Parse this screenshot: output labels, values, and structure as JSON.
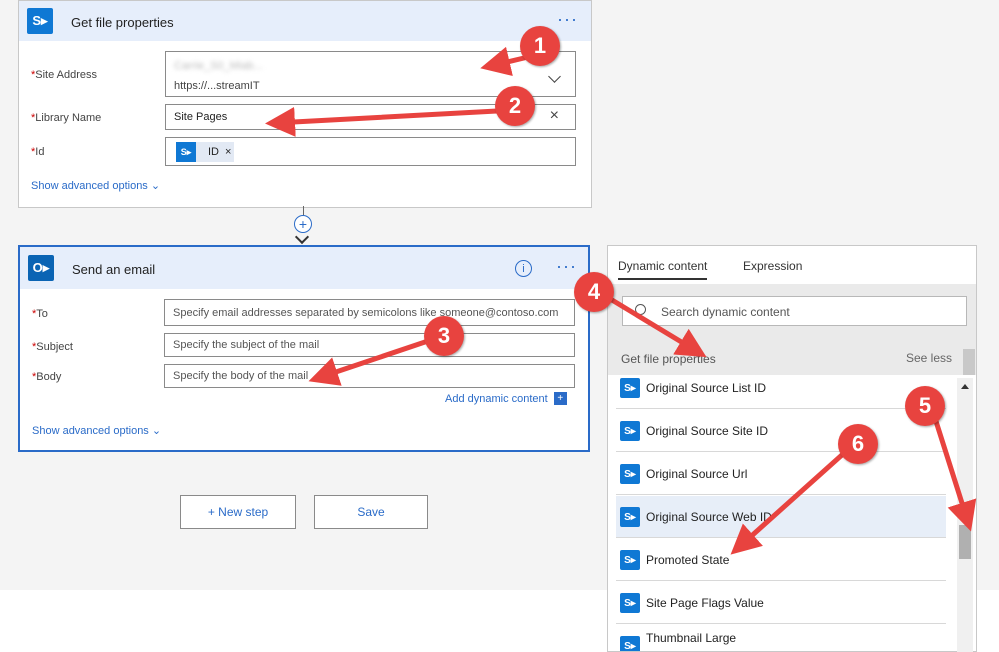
{
  "card1": {
    "title": "Get file properties",
    "site_address_label": "Site Address",
    "site_address_line1": "Carrie_S0_Miab...",
    "site_address_line2": "https://...streamIT",
    "library_label": "Library Name",
    "library_value": "Site Pages",
    "id_label": "Id",
    "id_token": "ID",
    "advanced": "Show advanced options"
  },
  "card2": {
    "title": "Send an email",
    "to_label": "To",
    "to_placeholder": "Specify email addresses separated by semicolons like someone@contoso.com",
    "subject_label": "Subject",
    "subject_placeholder": "Specify the subject of the mail",
    "body_label": "Body",
    "body_placeholder": "Specify the body of the mail",
    "add_dynamic": "Add dynamic content",
    "advanced": "Show advanced options"
  },
  "buttons": {
    "new_step": "+ New step",
    "save": "Save"
  },
  "panel": {
    "tab_dynamic": "Dynamic content",
    "tab_expression": "Expression",
    "search_placeholder": "Search dynamic content",
    "group_title": "Get file properties",
    "see_less": "See less",
    "items": [
      "Original Source List ID",
      "Original Source Site ID",
      "Original Source Url",
      "Original Source Web ID",
      "Promoted State",
      "Site Page Flags Value",
      "Thumbnail Large"
    ]
  },
  "markers": [
    "1",
    "2",
    "3",
    "4",
    "5",
    "6"
  ],
  "colors": {
    "accent": "#2a6bc8",
    "marker": "#e8433f",
    "header": "#e6eefb"
  }
}
